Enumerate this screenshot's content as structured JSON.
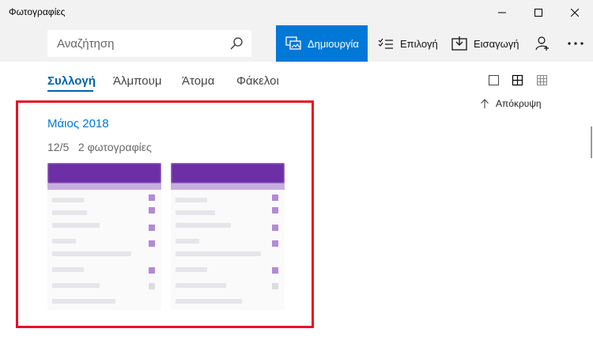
{
  "window": {
    "title": "Φωτογραφίες"
  },
  "toolbar": {
    "search_placeholder": "Αναζήτηση",
    "create_label": "Δημιουργία",
    "select_label": "Επιλογή",
    "import_label": "Εισαγωγή",
    "accent": "#0078d7"
  },
  "tabs": [
    {
      "label": "Συλλογή",
      "active": true
    },
    {
      "label": "Άλμπουμ",
      "active": false
    },
    {
      "label": "Άτομα",
      "active": false
    },
    {
      "label": "Φάκελοι",
      "active": false
    }
  ],
  "view": {
    "hide_label": "Απόκρυψη",
    "selected_view": "medium-grid"
  },
  "collection": {
    "month": "Μάιος 2018",
    "date": "12/5",
    "count_text": "2 φωτογραφίες",
    "thumbnail_color": "#6c2fa6"
  }
}
